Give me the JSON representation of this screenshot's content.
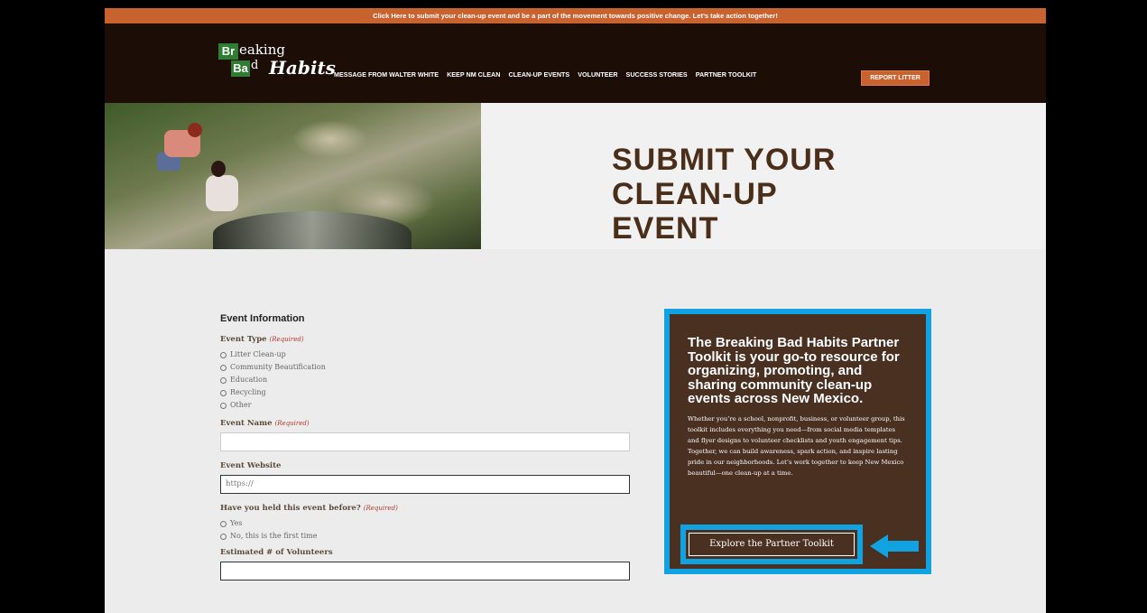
{
  "banner": {
    "text": "Click Here to submit your clean-up event and be a part of the movement towards positive change. Let’s take action together!"
  },
  "logo": {
    "el1": "Br",
    "w1": "eaking",
    "el2": "Ba",
    "w2": "d",
    "w3": "Habits"
  },
  "nav": {
    "items": [
      "MESSAGE FROM WALTER WHITE",
      "KEEP NM CLEAN",
      "CLEAN-UP EVENTS",
      "VOLUNTEER",
      "SUCCESS STORIES",
      "PARTNER TOOLKIT"
    ],
    "cta": "REPORT LITTER"
  },
  "hero": {
    "title_line1": "SUBMIT YOUR",
    "title_line2": "CLEAN-UP EVENT"
  },
  "form": {
    "heading": "Event Information",
    "event_type_label": "Event Type",
    "required_tag": "(Required)",
    "event_types": [
      "Litter Clean-up",
      "Community Beautification",
      "Education",
      "Recycling",
      "Other"
    ],
    "event_name_label": "Event Name",
    "event_website_label": "Event Website",
    "event_website_placeholder": "https://",
    "held_before_label": "Have you held this event before?",
    "held_before_options": [
      "Yes",
      "No, this is the first time"
    ],
    "volunteers_label": "Estimated # of Volunteers"
  },
  "toolkit": {
    "heading": "The Breaking Bad Habits Partner Toolkit is your go-to resource for organizing, promoting, and sharing community clean-up events across New Mexico.",
    "body": "Whether you’re a school, nonprofit, business, or volunteer group, this toolkit includes everything you need—from social media templates and flyer designs to volunteer checklists and youth engagement tips. Together, we can build awareness, spark action, and inspire lasting pride in our neighborhoods. Let’s work together to keep New Mexico beautiful—one clean-up at a time.",
    "cta": "Explore the Partner Toolkit"
  },
  "colors": {
    "accent": "#c8622f",
    "highlight": "#11a2e1",
    "brown": "#4a3021",
    "nav_bg": "#1c0d07"
  }
}
